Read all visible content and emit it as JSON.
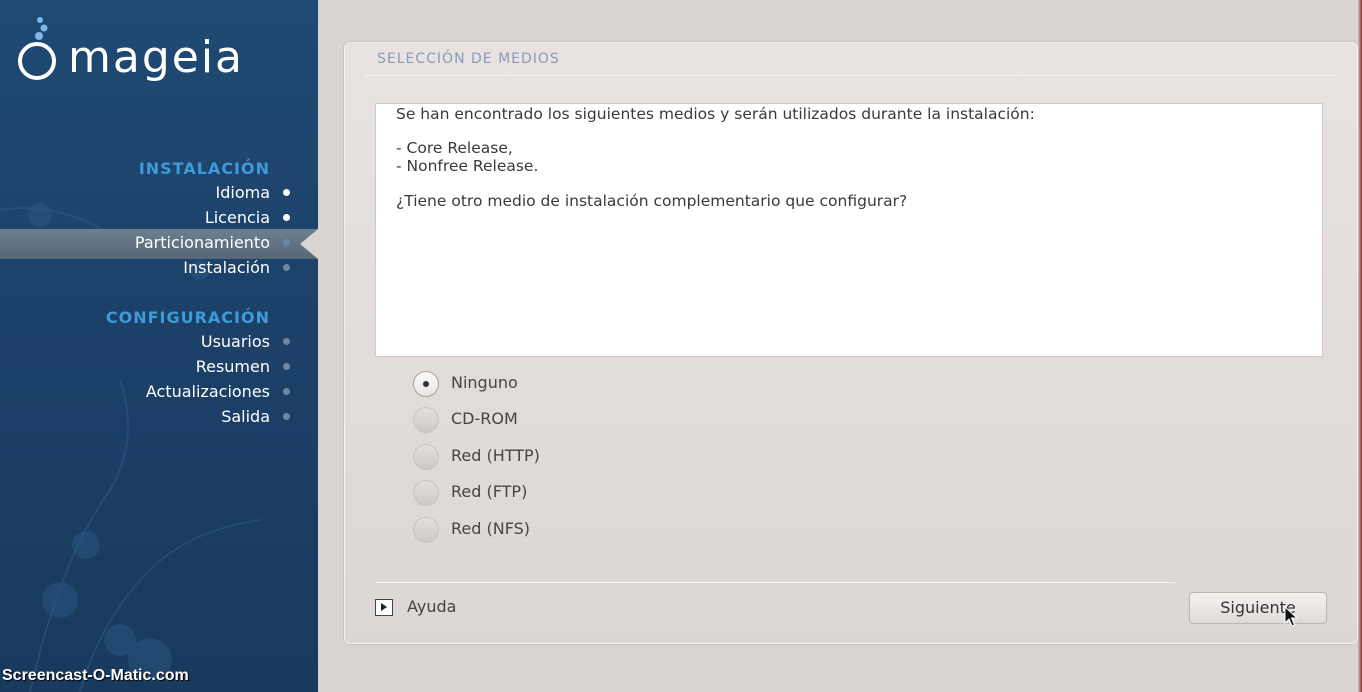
{
  "sidebar": {
    "logo_text": "mageia",
    "sections": [
      {
        "title": "INSTALACIÓN",
        "steps": [
          {
            "label": "Idioma",
            "state": "done"
          },
          {
            "label": "Licencia",
            "state": "done"
          },
          {
            "label": "Particionamiento",
            "state": "current"
          },
          {
            "label": "Instalación",
            "state": "pending"
          }
        ]
      },
      {
        "title": "CONFIGURACIÓN",
        "steps": [
          {
            "label": "Usuarios",
            "state": "pending"
          },
          {
            "label": "Resumen",
            "state": "pending"
          },
          {
            "label": "Actualizaciones",
            "state": "pending"
          },
          {
            "label": "Salida",
            "state": "pending"
          }
        ]
      }
    ],
    "watermark": "Screencast-O-Matic.com"
  },
  "main": {
    "title": "SELECCIÓN DE MEDIOS",
    "message": {
      "intro": "Se han encontrado los siguientes medios y serán utilizados durante la instalación:",
      "media": [
        "- Core Release,",
        "- Nonfree Release."
      ],
      "question": "¿Tiene otro medio de instalación complementario que configurar?"
    },
    "options": [
      {
        "label": "Ninguno",
        "selected": true
      },
      {
        "label": "CD-ROM",
        "selected": false
      },
      {
        "label": "Red (HTTP)",
        "selected": false
      },
      {
        "label": "Red (FTP)",
        "selected": false
      },
      {
        "label": "Red (NFS)",
        "selected": false
      }
    ],
    "help_label": "Ayuda",
    "next_label": "Siguiente"
  },
  "colors": {
    "sidebar_bg": "#1c4169",
    "section_title": "#3e9ad8",
    "panel_title": "#8a9bb8"
  },
  "icons": [
    "mageia-logo-icon",
    "bullet-dot-icon",
    "radio-icon",
    "help-expander-icon",
    "mouse-cursor-icon"
  ]
}
